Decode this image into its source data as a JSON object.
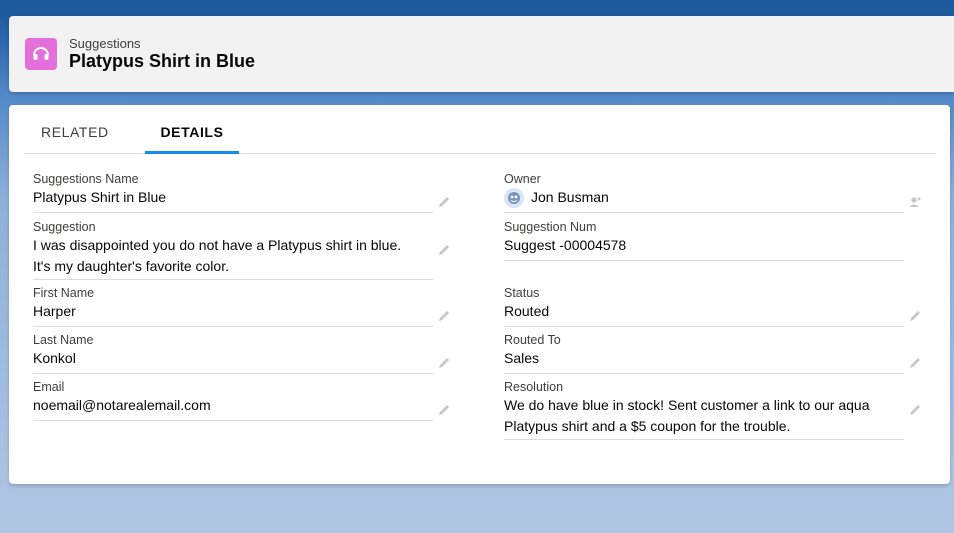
{
  "header": {
    "object_label": "Suggestions",
    "record_title": "Platypus Shirt in Blue",
    "icon": "headset-icon",
    "icon_color": "#e46fdc"
  },
  "tabs": [
    {
      "label": "RELATED",
      "active": false
    },
    {
      "label": "DETAILS",
      "active": true
    }
  ],
  "fields_left": {
    "name": {
      "label": "Suggestions Name",
      "value": "Platypus Shirt in Blue"
    },
    "suggestion": {
      "label": "Suggestion",
      "line1": "I was disappointed you do not have a Platypus shirt in blue.",
      "line2": "It's my daughter's favorite color."
    },
    "first_name": {
      "label": "First Name",
      "value": "Harper"
    },
    "last_name": {
      "label": "Last Name",
      "value": "Konkol"
    },
    "email": {
      "label": "Email",
      "value": "noemail@notarealemail.com"
    }
  },
  "fields_right": {
    "owner": {
      "label": "Owner",
      "value": "Jon Busman"
    },
    "suggestion_num": {
      "label": "Suggestion Num",
      "value": "Suggest -00004578"
    },
    "status": {
      "label": "Status",
      "value": "Routed"
    },
    "routed_to": {
      "label": "Routed To",
      "value": "Sales"
    },
    "resolution": {
      "label": "Resolution",
      "line1": "We do have blue in stock! Sent customer a link to our aqua",
      "line2": "Platypus shirt and a $5 coupon for the trouble."
    }
  },
  "colors": {
    "accent": "#1589ee",
    "link": "#0b5cab",
    "app_icon": "#e46fdc"
  }
}
